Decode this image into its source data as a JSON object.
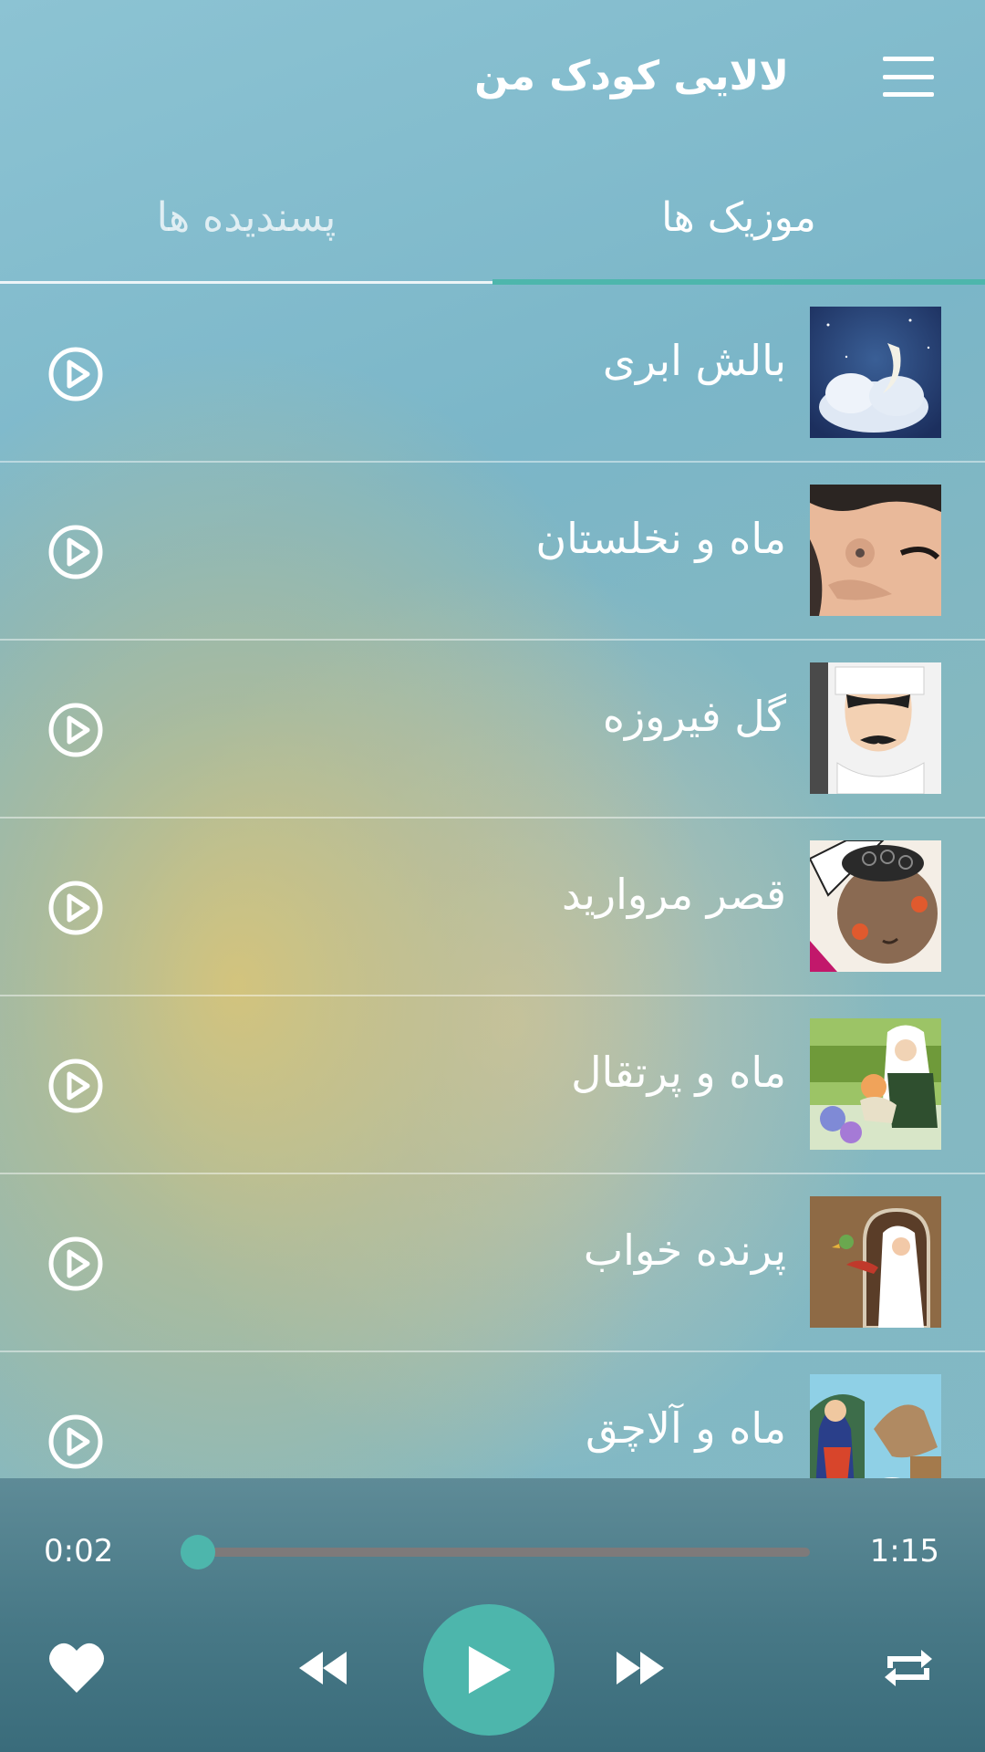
{
  "app": {
    "title": "لالایی کودک من"
  },
  "tabs": [
    {
      "label": "موزیک ها",
      "active": true
    },
    {
      "label": "پسندیده ها",
      "active": false
    }
  ],
  "songs": [
    {
      "title": "بالش ابری",
      "thumb": "moon-cloud"
    },
    {
      "title": "ماه و نخلستان",
      "thumb": "sleeping-face"
    },
    {
      "title": "گل فیروزه",
      "thumb": "mustache-man"
    },
    {
      "title": "قصر مروارید",
      "thumb": "child-face"
    },
    {
      "title": "ماه و پرتقال",
      "thumb": "grandmother-garden"
    },
    {
      "title": "پرنده خواب",
      "thumb": "woman-window-bird"
    },
    {
      "title": "ماه و آلاچق",
      "thumb": "woman-horse"
    }
  ],
  "player": {
    "current_time": "0:02",
    "total_time": "1:15",
    "progress": 0.027,
    "playing": false
  },
  "colors": {
    "accent": "#4db6ac",
    "track": "#7e7a7a",
    "player_bg": "#477886"
  },
  "icons": {
    "menu": "hamburger-icon",
    "row_play": "play-circle-icon",
    "favorite": "heart-icon",
    "rewind": "rewind-icon",
    "play": "play-icon",
    "fast_forward": "fast-forward-icon",
    "repeat": "repeat-icon"
  }
}
